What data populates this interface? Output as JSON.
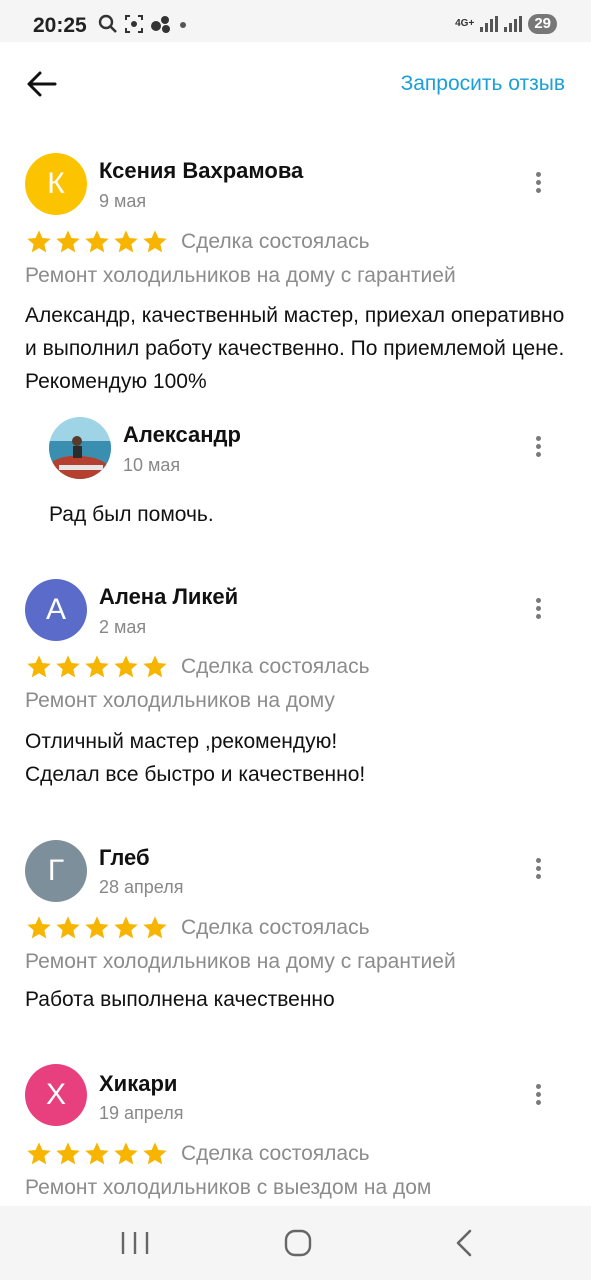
{
  "status_bar": {
    "time": "20:25",
    "network": "4G+",
    "battery": "29"
  },
  "header": {
    "request_review_label": "Запросить отзыв"
  },
  "reviews": [
    {
      "avatar_letter": "К",
      "avatar_color": "#fcc400",
      "author": "Ксения Вахрамова",
      "date": "9 мая",
      "rating": 5,
      "deal_status": "Сделка состоялась",
      "service": "Ремонт холодильников на дому с гарантией",
      "text": "Александр, качественный мастер, приехал оперативно и выполнил работу качественно. По приемлемой цене. Рекомендую 100%",
      "reply": {
        "author": "Александр",
        "date": "10 мая",
        "text": "Рад был помочь."
      }
    },
    {
      "avatar_letter": "А",
      "avatar_color": "#5b6bc9",
      "author": "Алена Ликей",
      "date": "2 мая",
      "rating": 5,
      "deal_status": "Сделка состоялась",
      "service": "Ремонт холодильников на дому",
      "text_lines": [
        "Отличный мастер ,рекомендую!",
        "Сделал все быстро и качественно!"
      ]
    },
    {
      "avatar_letter": "Г",
      "avatar_color": "#7d8f9a",
      "author": "Глеб",
      "date": "28 апреля",
      "rating": 5,
      "deal_status": "Сделка состоялась",
      "service": "Ремонт холодильников на дому с гарантией",
      "text": "Работа выполнена качественно"
    },
    {
      "avatar_letter": "Х",
      "avatar_color": "#e8407e",
      "author": "Хикари",
      "date": "19 апреля",
      "rating": 5,
      "deal_status": "Сделка состоялась",
      "service": "Ремонт холодильников с выездом на дом"
    }
  ],
  "colors": {
    "accent": "#1a9fd8",
    "star": "#f7b500"
  },
  "icons": [
    "back-arrow-icon",
    "more-vert-icon",
    "star-icon",
    "recent-apps-icon",
    "home-icon",
    "nav-back-icon"
  ]
}
